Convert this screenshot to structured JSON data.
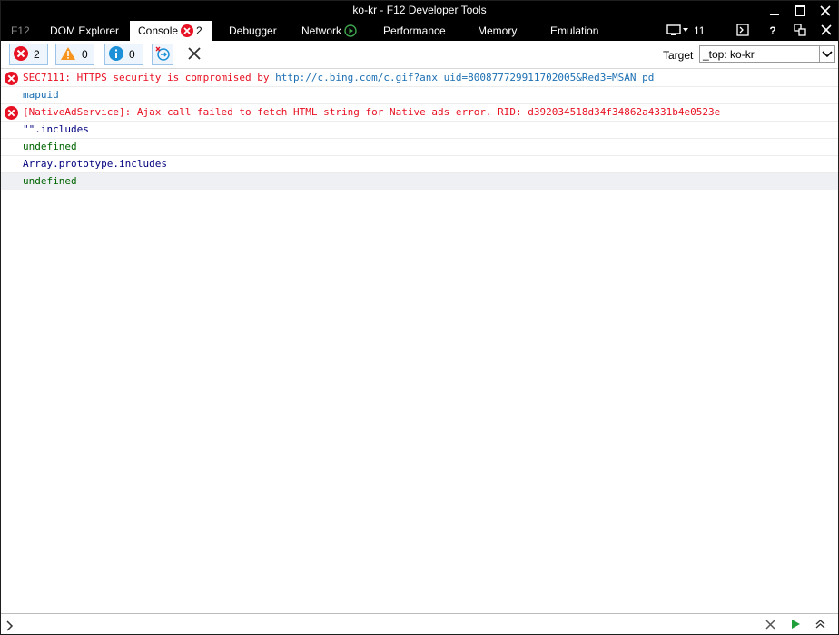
{
  "window": {
    "title": "ko-kr - F12 Developer Tools"
  },
  "tabs": {
    "f12": "F12",
    "dom_explorer": "DOM Explorer",
    "console": "Console",
    "console_error_count": "2",
    "debugger": "Debugger",
    "network": "Network",
    "performance": "Performance",
    "memory": "Memory",
    "emulation": "Emulation",
    "emulation_count": "11"
  },
  "toolbar": {
    "errors_count": "2",
    "warnings_count": "0",
    "info_count": "0",
    "target_label": "Target",
    "target_value": "_top: ko-kr"
  },
  "console": {
    "lines": [
      {
        "type": "error",
        "text": "SEC7111: HTTPS security is compromised by ",
        "link": "http://c.bing.com/c.gif?anx_uid=800877729911702005&Red3=MSAN_pd"
      },
      {
        "type": "output-link",
        "text": "mapuid"
      },
      {
        "type": "error",
        "text": "[NativeAdService]: Ajax call failed to fetch HTML string for Native ads error. RID: d392034518d34f34862a4331b4e0523e"
      },
      {
        "type": "input",
        "text": "\"\".includes"
      },
      {
        "type": "output",
        "text": "undefined"
      },
      {
        "type": "input",
        "text": "Array.prototype.includes"
      },
      {
        "type": "output",
        "text": "undefined"
      }
    ]
  },
  "colors": {
    "error": "#e81123",
    "link": "#1c6fb3",
    "input": "#00007f",
    "output": "#006400",
    "chrome": "#000000"
  },
  "icons": {
    "error": "error-x-icon",
    "warning": "warning-triangle-icon",
    "info": "info-circle-icon",
    "clear_on_nav": "clear-on-navigate-icon",
    "clear": "clear-console-icon",
    "network_record": "record-play-icon",
    "emulation_monitor": "monitor-icon",
    "dock": "dock-icon",
    "help": "help-icon",
    "undock": "undock-icon",
    "close": "close-icon",
    "run": "run-icon",
    "multiline": "multiline-icon",
    "prompt": "prompt-chevron-icon"
  }
}
